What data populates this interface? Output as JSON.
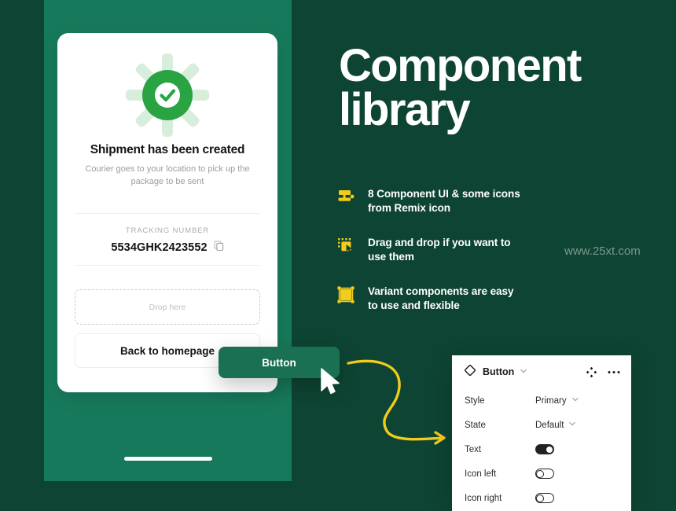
{
  "colors": {
    "background": "#0E4433",
    "panel_green": "#17795B",
    "accent_yellow": "#F2CB1C",
    "success_green": "#2AA343",
    "button_green": "#1A7052",
    "white": "#FFFFFF"
  },
  "phone": {
    "card": {
      "status_icon": "success-check-icon",
      "title": "Shipment has been created",
      "subtitle": "Courier goes to your location to pick up the package to be sent",
      "tracking_label": "TRACKING NUMBER",
      "tracking_value": "5534GHK2423552",
      "copy_icon": "copy-icon",
      "dropzone_label": "Drop here",
      "primary_action_label": "Back to homepage"
    }
  },
  "floating_component": {
    "label": "Button",
    "cursor_icon": "arrow-cursor-icon"
  },
  "hero": {
    "title_line1": "Component",
    "title_line2": "library"
  },
  "features": [
    {
      "icon": "paint-roller-icon",
      "line1": "8 Component UI & some icons",
      "line2": "from Remix icon"
    },
    {
      "icon": "drag-drop-icon",
      "line1": "Drag and drop if you want to",
      "line2": "use them"
    },
    {
      "icon": "variant-component-icon",
      "line1": "Variant components are easy",
      "line2": "to use and flexible"
    }
  ],
  "watermark": "www.25xt.com",
  "properties_panel": {
    "component_icon": "component-diamond-icon",
    "component_name": "Button",
    "chevron_icon": "chevron-down-icon",
    "reset_icon": "swap-instance-icon",
    "more_icon": "more-options-icon",
    "rows": [
      {
        "label": "Style",
        "type": "select",
        "value": "Primary"
      },
      {
        "label": "State",
        "type": "select",
        "value": "Default"
      },
      {
        "label": "Text",
        "type": "toggle",
        "value": "on"
      },
      {
        "label": "Icon left",
        "type": "toggle",
        "value": "off"
      },
      {
        "label": "Icon right",
        "type": "toggle",
        "value": "off"
      }
    ]
  }
}
